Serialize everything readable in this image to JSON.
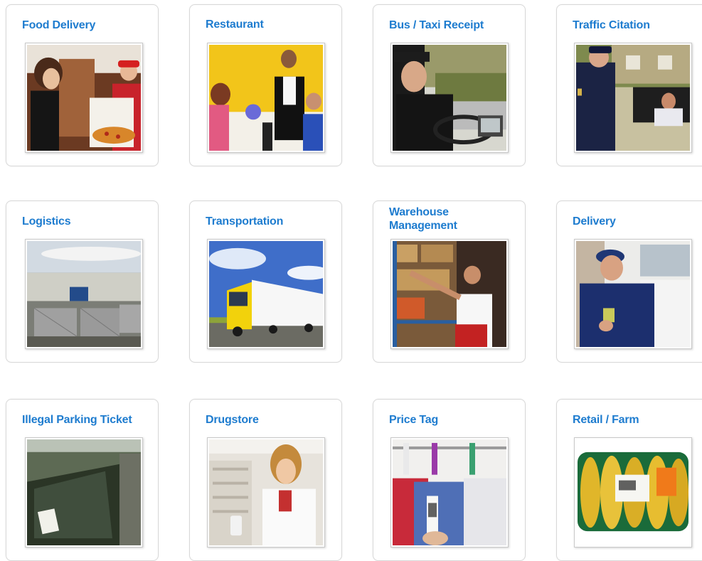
{
  "cards": [
    {
      "title": "Food Delivery",
      "photo_icon": "food-delivery-photo"
    },
    {
      "title": "Restaurant",
      "photo_icon": "restaurant-photo"
    },
    {
      "title": "Bus / Taxi Receipt",
      "photo_icon": "bus-taxi-photo"
    },
    {
      "title": "Traffic Citation",
      "photo_icon": "traffic-citation-photo"
    },
    {
      "title": "Logistics",
      "photo_icon": "logistics-photo"
    },
    {
      "title": "Transportation",
      "photo_icon": "transportation-photo"
    },
    {
      "title": "Warehouse Management",
      "photo_icon": "warehouse-photo"
    },
    {
      "title": "Delivery",
      "photo_icon": "delivery-photo"
    },
    {
      "title": "Illegal Parking Ticket",
      "photo_icon": "parking-ticket-photo"
    },
    {
      "title": "Drugstore",
      "photo_icon": "drugstore-photo"
    },
    {
      "title": "Price Tag",
      "photo_icon": "price-tag-photo"
    },
    {
      "title": "Retail / Farm",
      "photo_icon": "retail-farm-photo"
    }
  ],
  "colors": {
    "title": "#1e7ccf",
    "card_border": "#d8d8d8"
  }
}
